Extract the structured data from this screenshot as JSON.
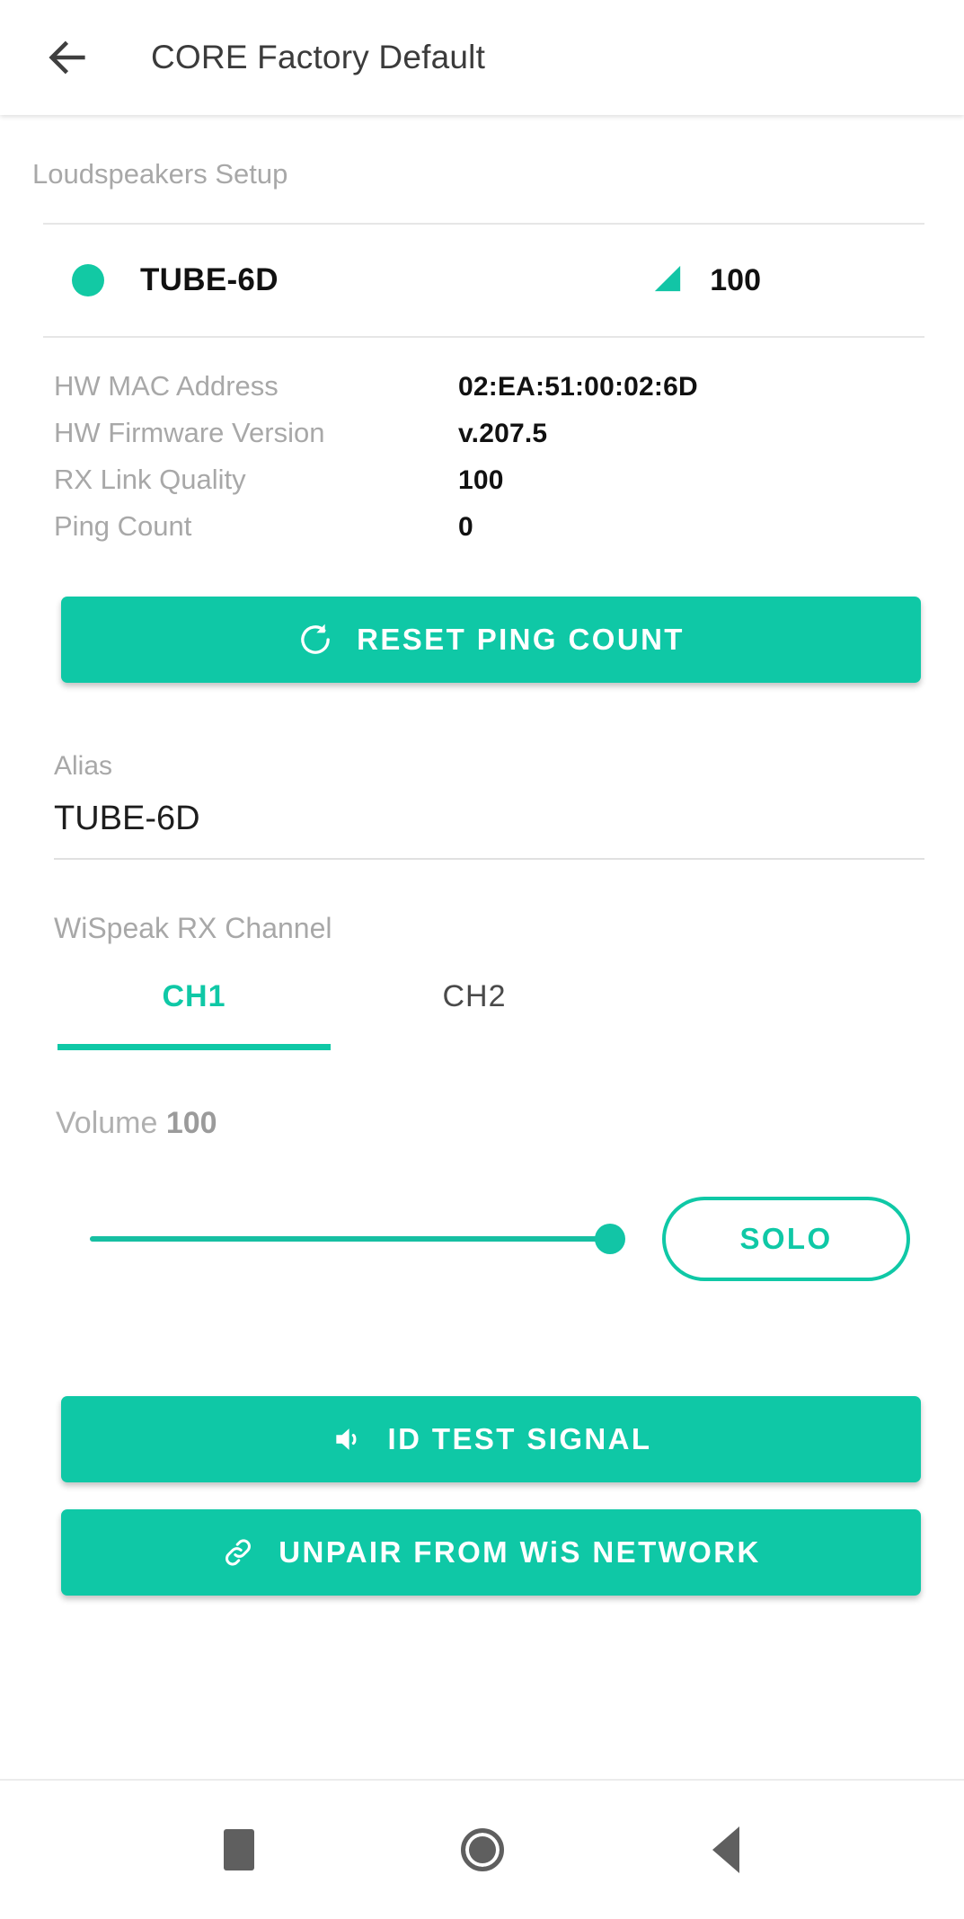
{
  "appbar": {
    "back_icon": "arrow-left-icon",
    "title": "CORE Factory Default"
  },
  "colors": {
    "accent": "#0fc8a6",
    "status_online": "#12c9a4",
    "label_gray": "#a8a8a8",
    "value_black": "#111111"
  },
  "section": {
    "label": "Loudspeakers Setup"
  },
  "device": {
    "status_icon": "status-dot-icon",
    "name": "TUBE-6D",
    "signal_icon": "signal-strength-icon",
    "signal_value": "100"
  },
  "info": {
    "rows": [
      {
        "key": "HW MAC Address",
        "value": "02:EA:51:00:02:6D"
      },
      {
        "key": "HW Firmware Version",
        "value": "v.207.5"
      },
      {
        "key": "RX Link Quality",
        "value": "100"
      },
      {
        "key": "Ping Count",
        "value": "0"
      }
    ]
  },
  "reset_button": {
    "icon": "refresh-icon",
    "label": "RESET PING COUNT"
  },
  "alias": {
    "label": "Alias",
    "value": "TUBE-6D",
    "placeholder": "Alias"
  },
  "rx_channel": {
    "label": "WiSpeak RX Channel",
    "tabs": [
      {
        "label": "CH1",
        "active": true
      },
      {
        "label": "CH2",
        "active": false
      }
    ]
  },
  "volume": {
    "label": "Volume",
    "value": "100",
    "percent": 100,
    "solo_label": "SOLO"
  },
  "id_test_button": {
    "icon": "speaker-icon",
    "label": "ID TEST SIGNAL"
  },
  "unpair_button": {
    "icon": "link-icon",
    "label": "UNPAIR FROM WiS NETWORK"
  },
  "navbar": {
    "recents_icon": "square-recents-icon",
    "home_icon": "circle-home-icon",
    "back_icon": "triangle-back-icon"
  }
}
